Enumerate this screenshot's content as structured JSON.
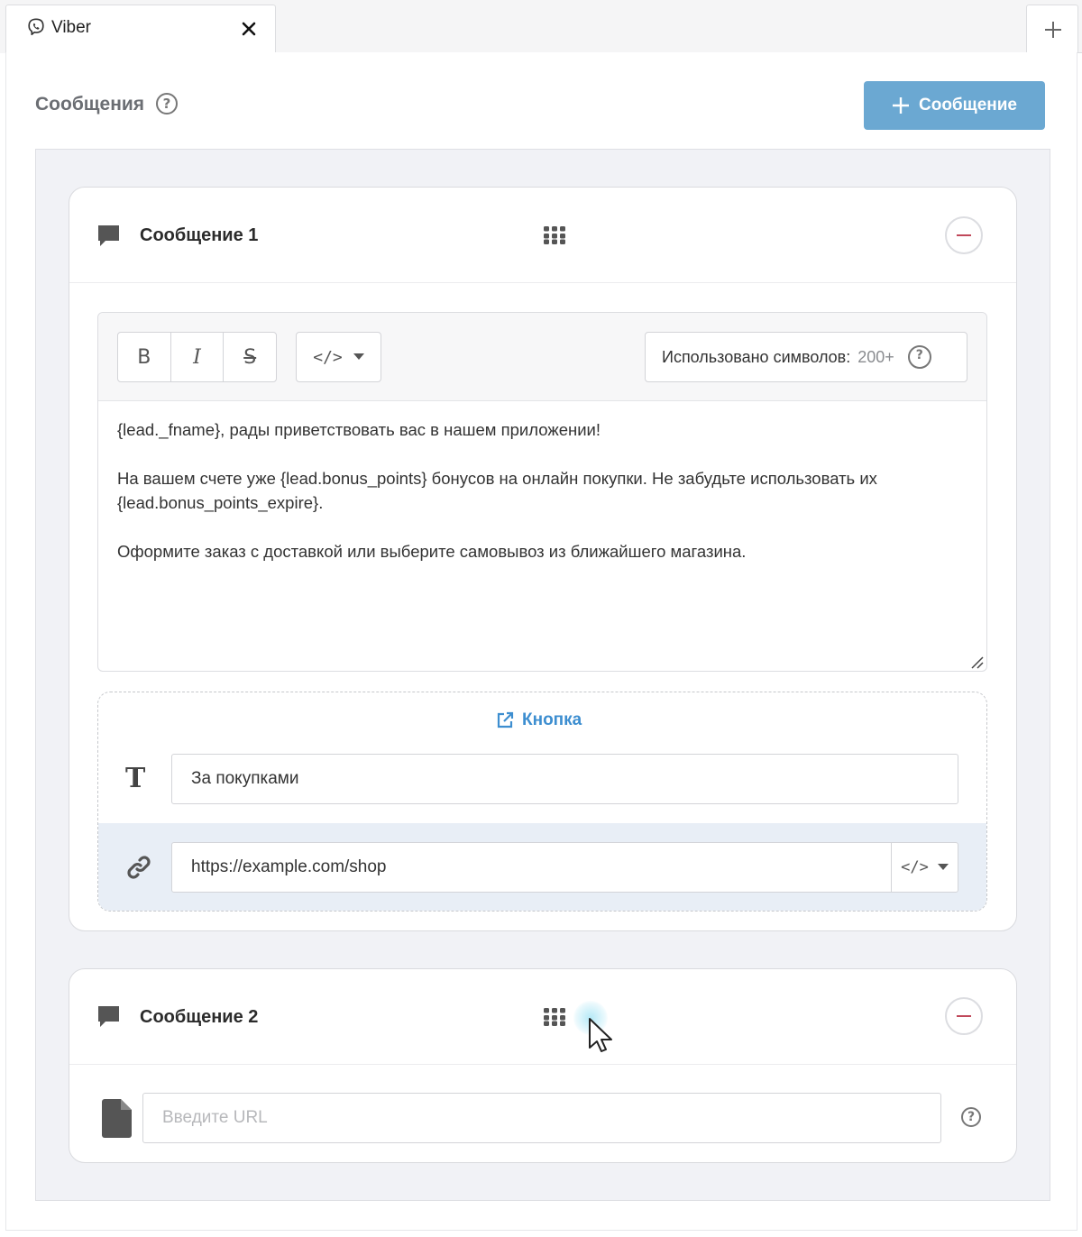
{
  "tab": {
    "title": "Viber",
    "icon": "viber-icon"
  },
  "section": {
    "title": "Сообщения"
  },
  "add_message_button": {
    "label": "Сообщение"
  },
  "messages": [
    {
      "title": "Сообщение 1",
      "toolbar": {
        "bold": "B",
        "italic": "I",
        "strike": "S",
        "code": "</>",
        "counter_label": "Использовано символов:",
        "counter_value": "200+"
      },
      "text_lines": [
        "{lead._fname}, рады приветствовать вас в нашем приложении!",
        "",
        "На вашем счете уже {lead.bonus_points} бонусов на онлайн покупки. Не забудьте использовать их",
        "{lead.bonus_points_expire}.",
        "",
        "Оформите заказ с доставкой или выберите самовывоз из ближайшего магазина."
      ],
      "button": {
        "label": "Кнопка",
        "text_value": "За покупками",
        "url_value": "https://example.com/shop",
        "code": "</>"
      }
    },
    {
      "title": "Сообщение 2",
      "url_placeholder": "Введите URL"
    }
  ],
  "colors": {
    "accent": "#6ba8d2",
    "link": "#3d8ed0",
    "danger": "#c0485a",
    "container_bg": "#f1f2f6"
  }
}
